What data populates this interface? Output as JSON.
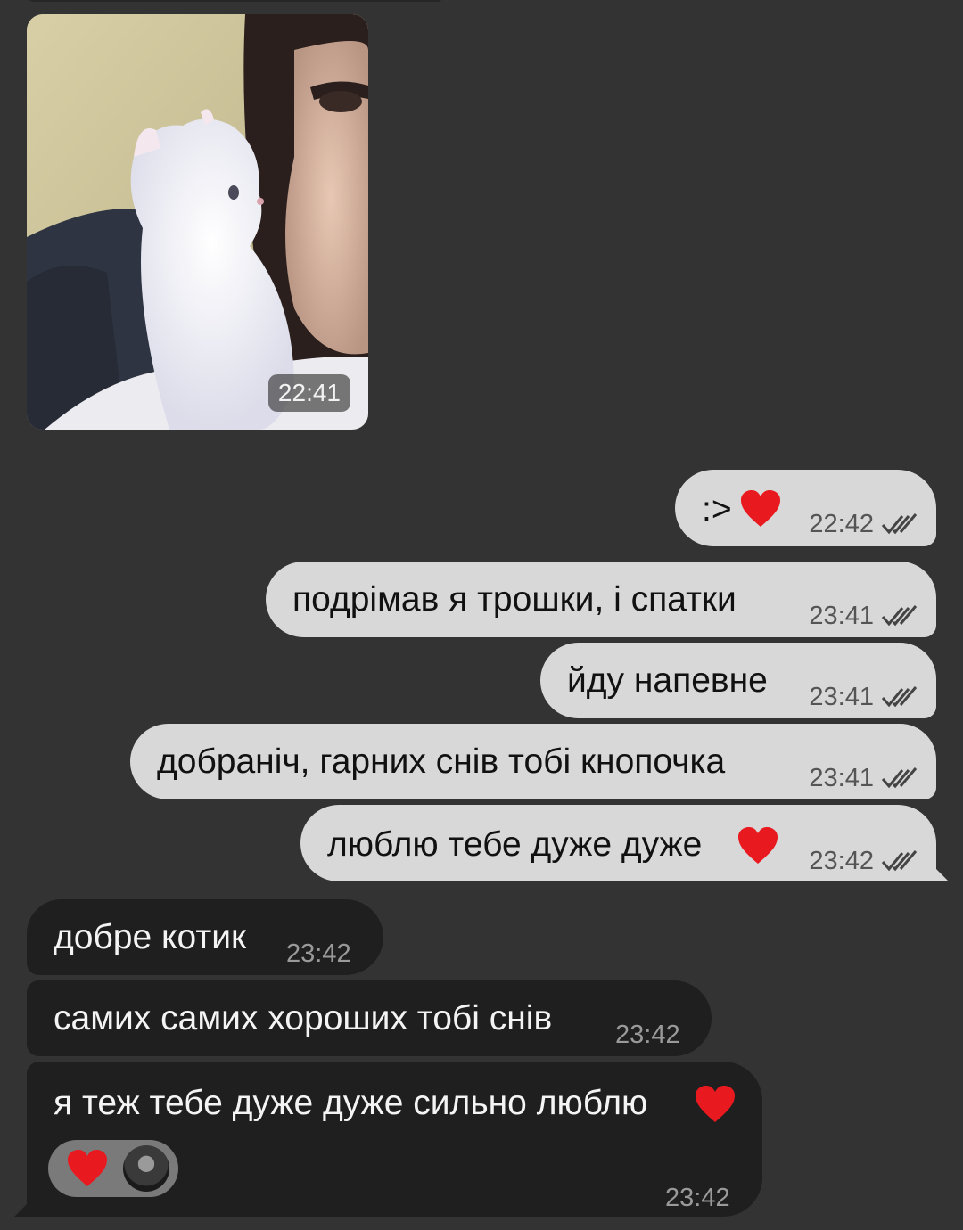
{
  "photo": {
    "time": "22:41"
  },
  "outgoing": [
    {
      "text": ":>",
      "time": "22:42",
      "emoji": "heart"
    },
    {
      "text": "подрімав я трошки, і спатки",
      "time": "23:41"
    },
    {
      "text": "йду напевне",
      "time": "23:41"
    },
    {
      "text": "добраніч, гарних снів тобі кнопочка",
      "time": "23:41"
    },
    {
      "text": "люблю тебе дуже дуже",
      "time": "23:42",
      "emoji": "heart"
    }
  ],
  "incoming": [
    {
      "text": "добре котик",
      "time": "23:42"
    },
    {
      "text": "самих самих хороших тобі снів",
      "time": "23:42"
    },
    {
      "text": "я теж тебе дуже дуже сильно люблю",
      "time": "23:42",
      "emoji": "heart",
      "reaction": "heart"
    }
  ],
  "colors": {
    "background": "#333333",
    "outgoing_bubble": "#d8d8d8",
    "incoming_bubble": "#1f1f1f",
    "heart": "#e8191f"
  }
}
